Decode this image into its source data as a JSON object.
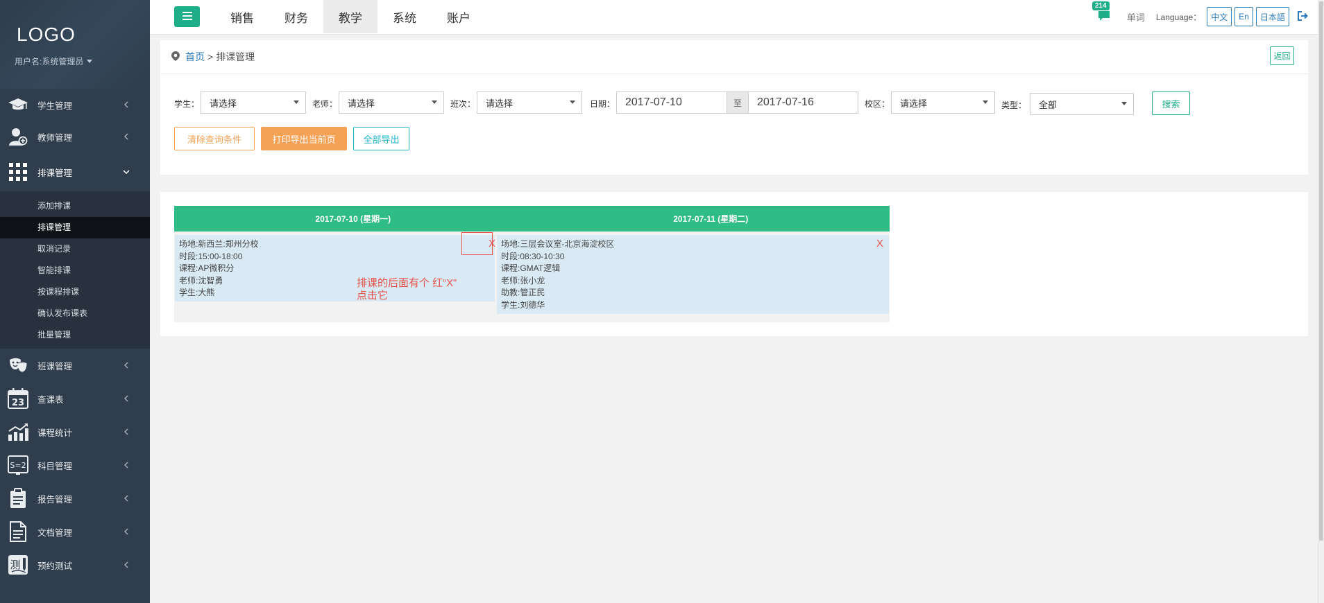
{
  "sidebar": {
    "logo": "LOGO",
    "user": "用户名:系统管理员",
    "items_before": [
      {
        "label": "学生管理",
        "icon": "graduation-cap-icon"
      },
      {
        "label": "教师管理",
        "icon": "teacher-user-icon"
      }
    ],
    "open_item": {
      "label": "排课管理",
      "icon": "grid-apps-icon"
    },
    "sub_items": [
      "添加排课",
      "排课管理",
      "取消记录",
      "智能排课",
      "按课程排课",
      "确认发布课表",
      "批量管理"
    ],
    "active_sub": "排课管理",
    "items_after": [
      {
        "label": "班课管理",
        "icon": "theater-masks-icon"
      },
      {
        "label": "查课表",
        "icon": "calendar-23-icon"
      },
      {
        "label": "课程统计",
        "icon": "bar-chart-trend-icon"
      },
      {
        "label": "科目管理",
        "icon": "blackboard-formula-icon"
      },
      {
        "label": "报告管理",
        "icon": "clipboard-report-icon"
      },
      {
        "label": "文档管理",
        "icon": "document-icon"
      },
      {
        "label": "预约测试",
        "icon": "test-pen-icon"
      }
    ]
  },
  "topbar": {
    "tabs": [
      "销售",
      "财务",
      "教学",
      "系统",
      "账户"
    ],
    "active_tab": "教学",
    "badge": "214",
    "words": "单词",
    "language_label": "Language：",
    "languages": [
      "中文",
      "En",
      "日本語"
    ]
  },
  "breadcrumb": {
    "home": "首页",
    "separator": ">",
    "current": "排课管理"
  },
  "back_label": "返回",
  "filters": {
    "student": {
      "label": "学生：",
      "value": "请选择"
    },
    "teacher": {
      "label": "老师：",
      "value": "请选择"
    },
    "class_no": {
      "label": "班次：",
      "value": "请选择"
    },
    "date": {
      "label": "日期：",
      "from": "2017-07-10",
      "to_label": "至",
      "to": "2017-07-16"
    },
    "campus": {
      "label": "校区：",
      "value": "请选择"
    },
    "type": {
      "label": "类型：",
      "value": "全部"
    },
    "search_label": "搜索"
  },
  "actions": {
    "clear": "清除查询条件",
    "print": "打印导出当前页",
    "export_all": "全部导出"
  },
  "schedule": {
    "days": [
      "2017-07-10 (星期一)",
      "2017-07-11 (星期二)"
    ],
    "cards": [
      {
        "lines": [
          "场地:新西兰:郑州分校",
          "时段:15:00-18:00",
          "课程:AP微积分",
          "老师:沈智勇",
          "学生:大熊"
        ],
        "close": "X"
      },
      {
        "lines": [
          "场地:三层会议室-北京海淀校区",
          "时段:08:30-10:30",
          "课程:GMAT逻辑",
          "老师:张小龙",
          "助教:管正民",
          "学生:刘德华"
        ],
        "close": "X"
      }
    ]
  },
  "annotation": {
    "line1": "排课的后面有个 红“X”",
    "line2": "点击它"
  },
  "colors": {
    "sidebar": "#2f3d4c",
    "accent": "#1fae8a",
    "table_header": "#2fbc85",
    "orange": "#f5a256",
    "red": "#e8504a",
    "link": "#2b7bbd"
  }
}
